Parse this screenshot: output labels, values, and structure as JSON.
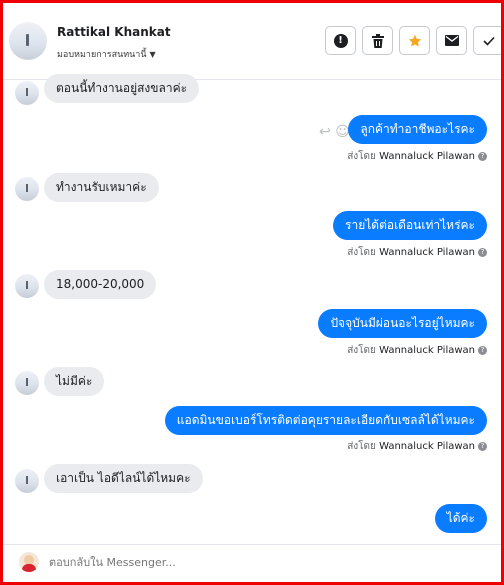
{
  "header": {
    "contact_name": "Rattikal Khankat",
    "assign_label": "มอบหมายการสนทนานี้",
    "actions": [
      {
        "name": "report-button",
        "icon": "alert-circle-icon"
      },
      {
        "name": "delete-button",
        "icon": "trash-icon"
      },
      {
        "name": "star-button",
        "icon": "star-icon"
      },
      {
        "name": "mark-unread-button",
        "icon": "envelope-icon"
      },
      {
        "name": "mark-done-button",
        "icon": "check-icon"
      }
    ]
  },
  "messages": [
    {
      "direction": "in",
      "text": "ตอนนี้ทำงานอยู่สงขลาค่ะ"
    },
    {
      "direction": "out",
      "text": "ลูกค้าทำอาชีพอะไรคะ",
      "sent_by_prefix": "ส่งโดย",
      "sent_by_name": "Wannaluck Pilawan"
    },
    {
      "direction": "in",
      "text": "ทำงานรับเหมาค่ะ"
    },
    {
      "direction": "out",
      "text": "รายได้ต่อเดือนเท่าไหร่คะ",
      "sent_by_prefix": "ส่งโดย",
      "sent_by_name": "Wannaluck Pilawan"
    },
    {
      "direction": "in",
      "text": "18,000-20,000"
    },
    {
      "direction": "out",
      "text": "ปัจจุบันมีผ่อนอะไรอยู่ไหมคะ",
      "sent_by_prefix": "ส่งโดย",
      "sent_by_name": "Wannaluck Pilawan"
    },
    {
      "direction": "in",
      "text": "ไม่มีค่ะ"
    },
    {
      "direction": "out",
      "text": "แอดมินขอเบอร์โทรติดต่อคุยรายละเอียดกับเซลล์ได้ไหมคะ",
      "sent_by_prefix": "ส่งโดย",
      "sent_by_name": "Wannaluck Pilawan"
    },
    {
      "direction": "in",
      "text": "เอาเป็น ไอดีไลน์ได้ไหมคะ"
    },
    {
      "direction": "out",
      "text": "ได้ค่ะ"
    }
  ],
  "composer": {
    "placeholder": "ตอบกลับใน Messenger..."
  },
  "colors": {
    "frame_border": "#ee0000",
    "outgoing_bubble": "#0a7cff",
    "incoming_bubble": "#e9ebee",
    "star_icon": "#f5a623"
  }
}
